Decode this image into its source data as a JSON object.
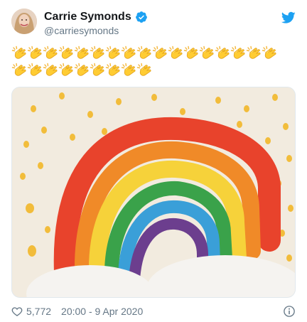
{
  "tweet": {
    "author": {
      "display_name": "Carrie Symonds",
      "handle": "@carriesymonds",
      "verified": true
    },
    "emoji_rows": [
      {
        "count": 17,
        "icon": "clapping-hands-emoji"
      },
      {
        "count": 9,
        "icon": "clapping-hands-emoji"
      }
    ],
    "photo": {
      "description_icon": "rainbow-drawing"
    },
    "stats": {
      "likes": "5,772",
      "timestamp": "20:00 - 9 Apr 2020"
    }
  },
  "colors": {
    "brand_blue": "#1da1f2",
    "text_secondary": "#657786",
    "text_primary": "#14171a"
  }
}
